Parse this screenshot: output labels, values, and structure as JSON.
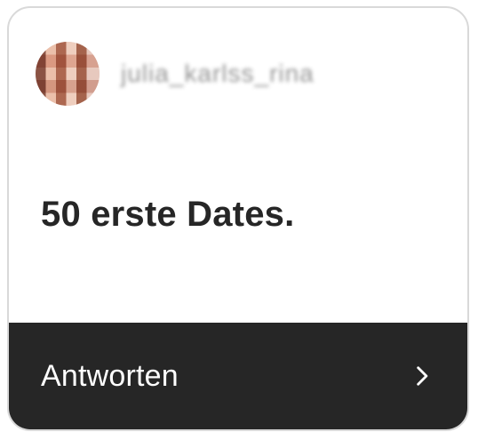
{
  "card": {
    "username": "julia_karlss_rina",
    "message": "50 erste Dates.",
    "reply_label": "Antworten"
  },
  "icons": {
    "avatar": "avatar",
    "chevron": "chevron-right-icon"
  },
  "colors": {
    "card_border": "#d9d9d9",
    "footer_bg": "#262626",
    "title_text": "#262626",
    "username_text": "#8f8f8f",
    "footer_text": "#ffffff"
  }
}
